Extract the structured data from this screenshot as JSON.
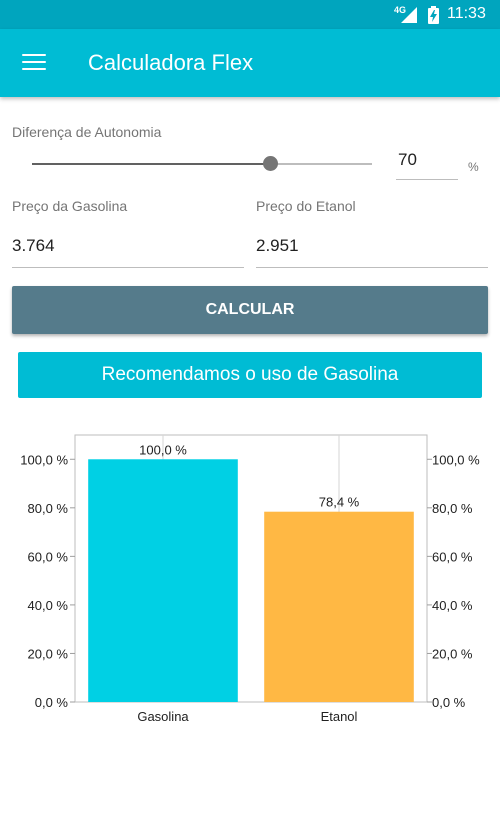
{
  "status_bar": {
    "network": "4G",
    "time": "11:33",
    "icons": [
      "signal-icon",
      "battery-charging-icon"
    ]
  },
  "app_bar": {
    "title": "Calculadora Flex",
    "menu_icon": "menu-icon"
  },
  "form": {
    "autonomy_label": "Diferença de Autonomia",
    "autonomy_value": "70",
    "autonomy_fraction": 0.7,
    "autonomy_unit": "%",
    "gasoline_label": "Preço da Gasolina",
    "gasoline_value": "3.764",
    "ethanol_label": "Preço do Etanol",
    "ethanol_value": "2.951",
    "calculate_label": "CALCULAR"
  },
  "result": {
    "message": "Recomendamos o uso de Gasolina"
  },
  "colors": {
    "primary": "#00BCD4",
    "primary_dark": "#00A5BE",
    "button": "#557B8B",
    "gasoline_bar": "#00D0E4",
    "ethanol_bar": "#FFB844"
  },
  "chart_data": {
    "type": "bar",
    "categories": [
      "Gasolina",
      "Etanol"
    ],
    "values": [
      100.0,
      78.4
    ],
    "value_labels": [
      "100,0 %",
      "78,4 %"
    ],
    "y_ticks": [
      "0,0 %",
      "20,0 %",
      "40,0 %",
      "60,0 %",
      "80,0 %",
      "100,0 %"
    ],
    "ylim": [
      0,
      110
    ],
    "grid": true,
    "axes": "left-and-right"
  }
}
